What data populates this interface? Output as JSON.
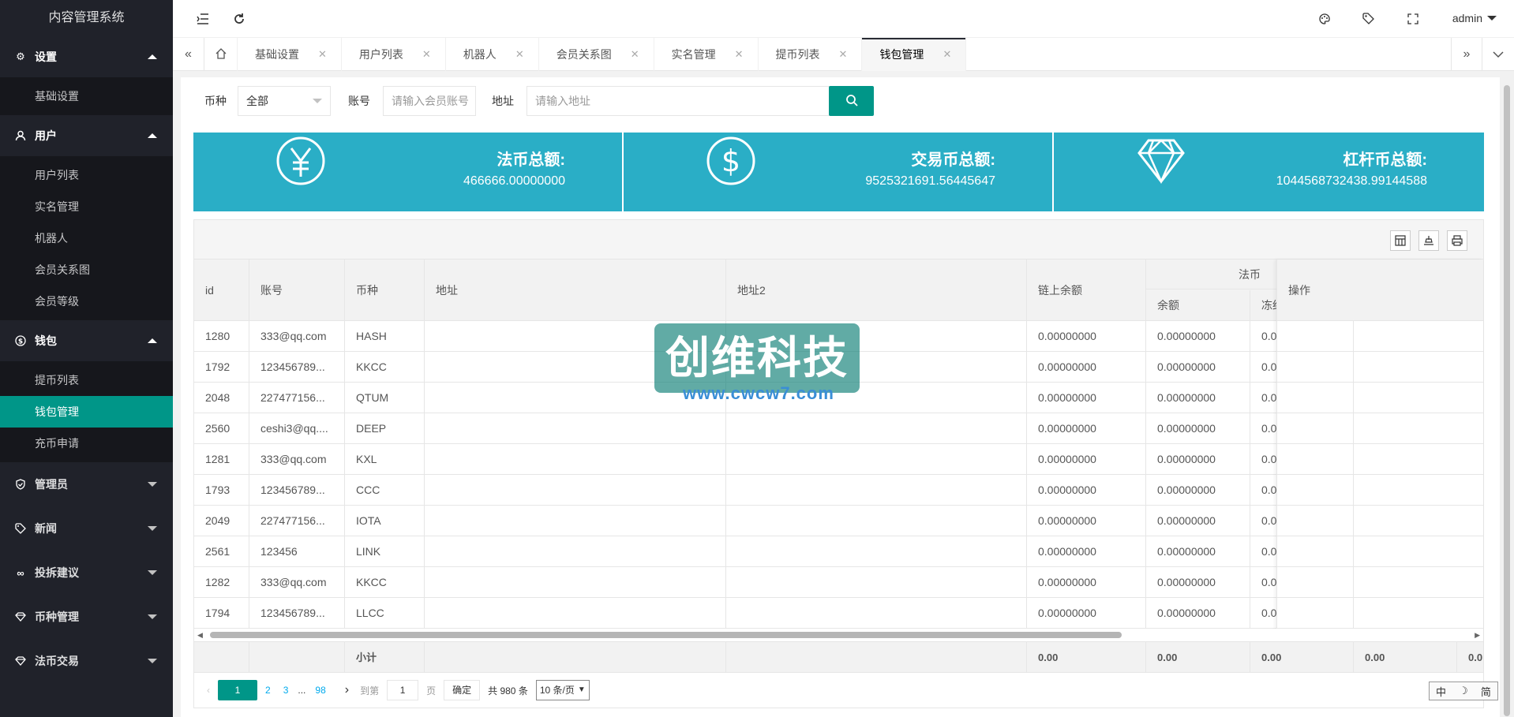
{
  "app": {
    "title": "内容管理系统"
  },
  "header": {
    "user": "admin"
  },
  "sidebar": {
    "groups": [
      {
        "label": "设置",
        "icon": "gear-icon",
        "items": [
          "基础设置"
        ]
      },
      {
        "label": "用户",
        "icon": "user-icon",
        "items": [
          "用户列表",
          "实名管理",
          "机器人",
          "会员关系图",
          "会员等级"
        ]
      },
      {
        "label": "钱包",
        "icon": "dollar-icon",
        "items": [
          "提币列表",
          "钱包管理",
          "充币申请"
        ]
      },
      {
        "label": "管理员",
        "icon": "shield-icon"
      },
      {
        "label": "新闻",
        "icon": "tag-icon"
      },
      {
        "label": "投拆建议",
        "icon": "link-icon"
      },
      {
        "label": "币种管理",
        "icon": "diamond-icon"
      },
      {
        "label": "法币交易",
        "icon": "diamond-icon"
      }
    ]
  },
  "tabs": [
    "基础设置",
    "用户列表",
    "机器人",
    "会员关系图",
    "实名管理",
    "提币列表",
    "钱包管理"
  ],
  "filter": {
    "currency_label": "币种",
    "currency_value": "全部",
    "account_label": "账号",
    "account_placeholder": "请输入会员账号",
    "address_label": "地址",
    "address_placeholder": "请输入地址"
  },
  "cards": [
    {
      "title": "法币总额:",
      "value": "466666.00000000",
      "icon": "yen-icon"
    },
    {
      "title": "交易币总额:",
      "value": "9525321691.56445647",
      "icon": "dollar-icon"
    },
    {
      "title": "杠杆币总额:",
      "value": "1044568732438.99144588",
      "icon": "diamond-icon"
    }
  ],
  "table": {
    "headers": {
      "id": "id",
      "account": "账号",
      "currency": "币种",
      "address": "地址",
      "address2": "地址2",
      "chain_balance": "链上余额",
      "fiat_group": "法币",
      "balance": "余额",
      "frozen": "冻结",
      "ops": "操作"
    },
    "rows": [
      {
        "id": "1280",
        "account": "333@qq.com",
        "currency": "HASH",
        "chain": "0.00000000",
        "balance": "0.00000000",
        "frozen": "0.0"
      },
      {
        "id": "1792",
        "account": "123456789...",
        "currency": "KKCC",
        "chain": "0.00000000",
        "balance": "0.00000000",
        "frozen": "0.0"
      },
      {
        "id": "2048",
        "account": "227477156...",
        "currency": "QTUM",
        "chain": "0.00000000",
        "balance": "0.00000000",
        "frozen": "0.0"
      },
      {
        "id": "2560",
        "account": "ceshi3@qq....",
        "currency": "DEEP",
        "chain": "0.00000000",
        "balance": "0.00000000",
        "frozen": "0.0"
      },
      {
        "id": "1281",
        "account": "333@qq.com",
        "currency": "KXL",
        "chain": "0.00000000",
        "balance": "0.00000000",
        "frozen": "0.0"
      },
      {
        "id": "1793",
        "account": "123456789...",
        "currency": "CCC",
        "chain": "0.00000000",
        "balance": "0.00000000",
        "frozen": "0.0"
      },
      {
        "id": "2049",
        "account": "227477156...",
        "currency": "IOTA",
        "chain": "0.00000000",
        "balance": "0.00000000",
        "frozen": "0.0"
      },
      {
        "id": "2561",
        "account": "123456",
        "currency": "LINK",
        "chain": "0.00000000",
        "balance": "0.00000000",
        "frozen": "0.0"
      },
      {
        "id": "1282",
        "account": "333@qq.com",
        "currency": "KKCC",
        "chain": "0.00000000",
        "balance": "0.00000000",
        "frozen": "0.0"
      },
      {
        "id": "1794",
        "account": "123456789...",
        "currency": "LLCC",
        "chain": "0.00000000",
        "balance": "0.00000000",
        "frozen": "0.0"
      }
    ],
    "totals": {
      "label": "小计",
      "chain": "0.00",
      "balance": "0.00",
      "frozen": "0.00",
      "col4": "0.00",
      "col5": "0.0"
    }
  },
  "pager": {
    "pages": [
      "1",
      "2",
      "3",
      "...",
      "98"
    ],
    "goto_label": "到第",
    "page_value": "1",
    "page_unit": "页",
    "confirm": "确定",
    "total": "共 980 条",
    "per_page": "10 条/页"
  },
  "watermark": {
    "text": "创维科技",
    "url": "www.cwcw7.com"
  },
  "ime": {
    "a": "中",
    "b": "☽",
    "c": "简"
  },
  "colors": {
    "accent": "#009688",
    "sidebar": "#20222a",
    "card": "#2aaec6"
  }
}
